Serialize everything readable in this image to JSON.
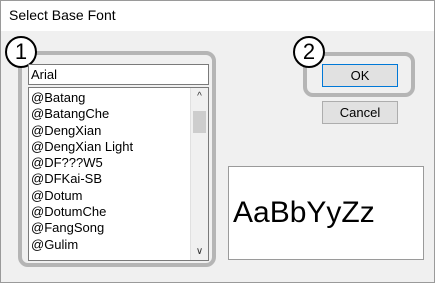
{
  "window": {
    "title": "Select Base Font"
  },
  "callouts": {
    "one": "1",
    "two": "2"
  },
  "font_input": {
    "value": "Arial"
  },
  "font_list": {
    "items": [
      "@Batang",
      "@BatangChe",
      "@DengXian",
      "@DengXian Light",
      "@DF???W5",
      "@DFKai-SB",
      "@Dotum",
      "@DotumChe",
      "@FangSong",
      "@Gulim"
    ]
  },
  "buttons": {
    "ok": "OK",
    "cancel": "Cancel"
  },
  "preview": {
    "sample_text": "AaBbYyZz"
  },
  "icons": {
    "scroll_up": "chevron-up-icon",
    "scroll_down": "chevron-down-icon"
  }
}
